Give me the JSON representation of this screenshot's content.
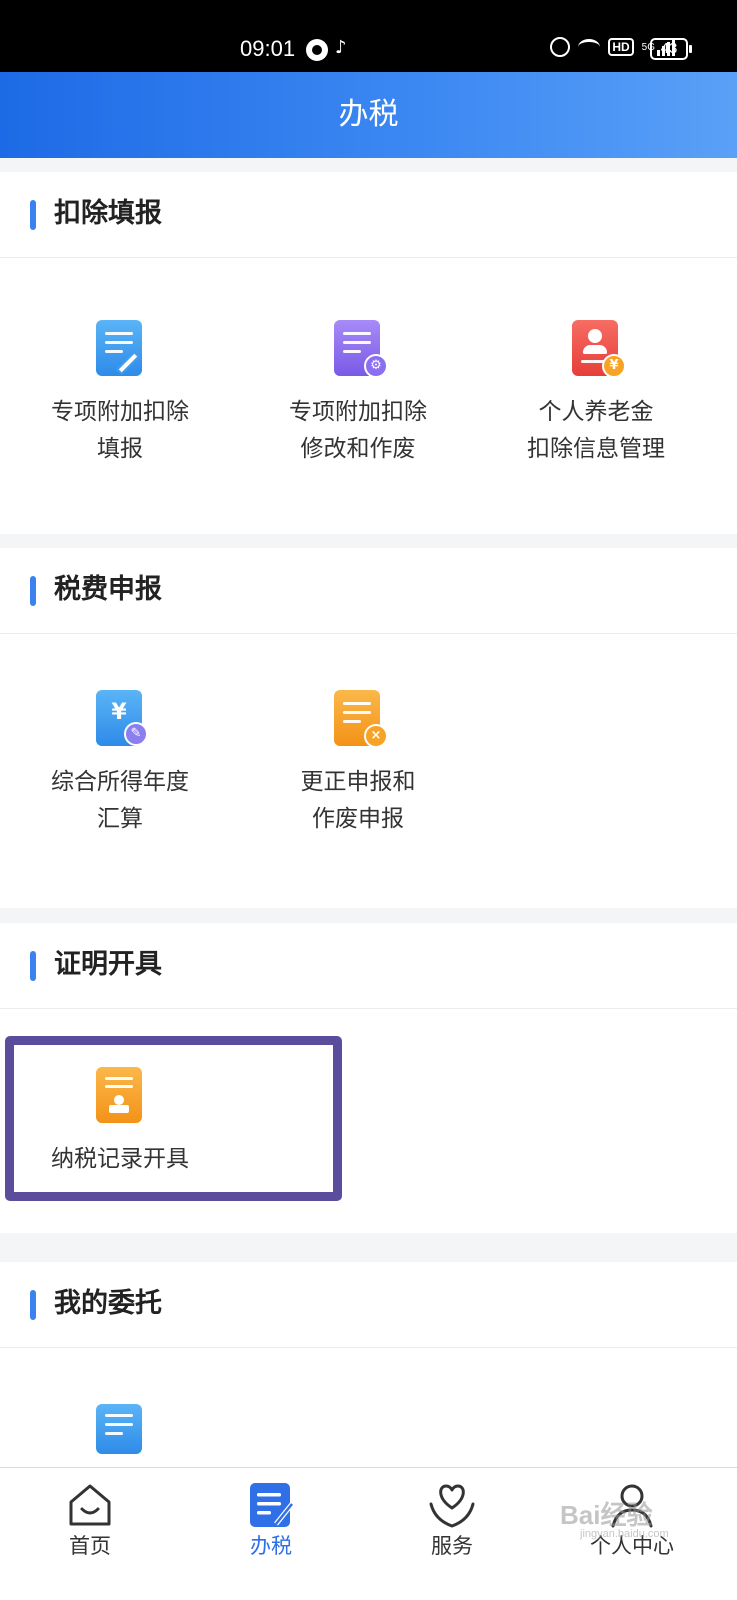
{
  "status_bar": {
    "time": "09:01",
    "network": "HD",
    "signal": "5G",
    "battery": "43"
  },
  "header": {
    "title": "办税"
  },
  "sections": [
    {
      "title": "扣除填报",
      "items": [
        {
          "label_line1": "专项附加扣除",
          "label_line2": "填报",
          "icon": "edit-document-icon",
          "color": "#3f9ef0"
        },
        {
          "label_line1": "专项附加扣除",
          "label_line2": "修改和作废",
          "icon": "document-settings-icon",
          "color": "#8b6ff0"
        },
        {
          "label_line1": "个人养老金",
          "label_line2": "扣除信息管理",
          "icon": "pension-card-icon",
          "color": "#f0534d"
        }
      ]
    },
    {
      "title": "税费申报",
      "items": [
        {
          "label_line1": "综合所得年度",
          "label_line2": "汇算",
          "icon": "yuan-document-icon",
          "color": "#3f9ef0"
        },
        {
          "label_line1": "更正申报和",
          "label_line2": "作废申报",
          "icon": "document-cancel-icon",
          "color": "#f7a326"
        }
      ]
    },
    {
      "title": "证明开具",
      "items": [
        {
          "label_line1": "纳税记录开具",
          "icon": "certificate-stamp-icon",
          "color": "#f7a326"
        }
      ]
    },
    {
      "title": "我的委托",
      "items": [
        {
          "icon": "delegation-document-icon",
          "color": "#3f9ef0"
        }
      ]
    }
  ],
  "tabs": [
    {
      "label": "首页",
      "icon": "home-icon"
    },
    {
      "label": "办税",
      "icon": "tax-document-icon",
      "active": true
    },
    {
      "label": "服务",
      "icon": "heart-hand-icon"
    },
    {
      "label": "个人中心",
      "icon": "person-icon"
    }
  ],
  "watermark": {
    "text": "Bai经验",
    "sub": "jingyan.baidu.com"
  },
  "colors": {
    "accent": "#2f6fe8",
    "header_start": "#1d6ae6",
    "highlight_border": "#5b4c9c"
  }
}
